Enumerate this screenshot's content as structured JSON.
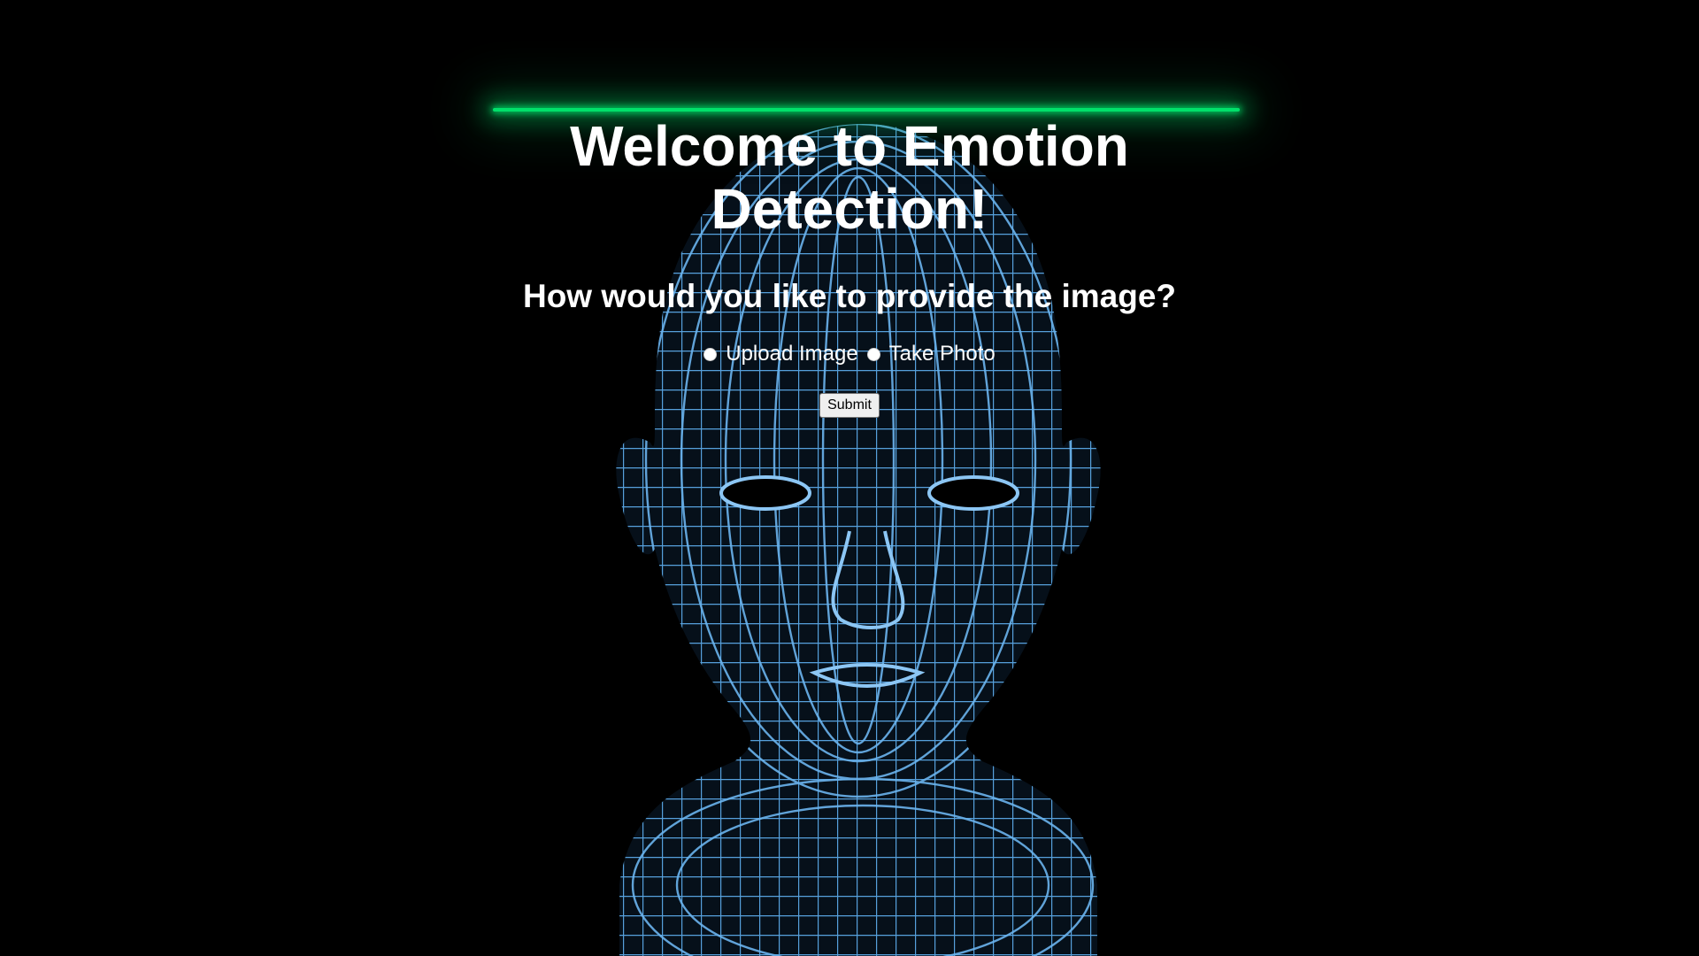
{
  "header": {
    "title": "Welcome to Emotion Detection!",
    "accent_color": "#00e06a"
  },
  "form": {
    "question": "How would you like to provide the image?",
    "options": [
      {
        "label": "Upload Image",
        "selected": false
      },
      {
        "label": "Take Photo",
        "selected": false
      }
    ],
    "submit_label": "Submit"
  },
  "background": {
    "icon": "wireframe-head-icon",
    "mesh_color": "#5aa8e6"
  }
}
